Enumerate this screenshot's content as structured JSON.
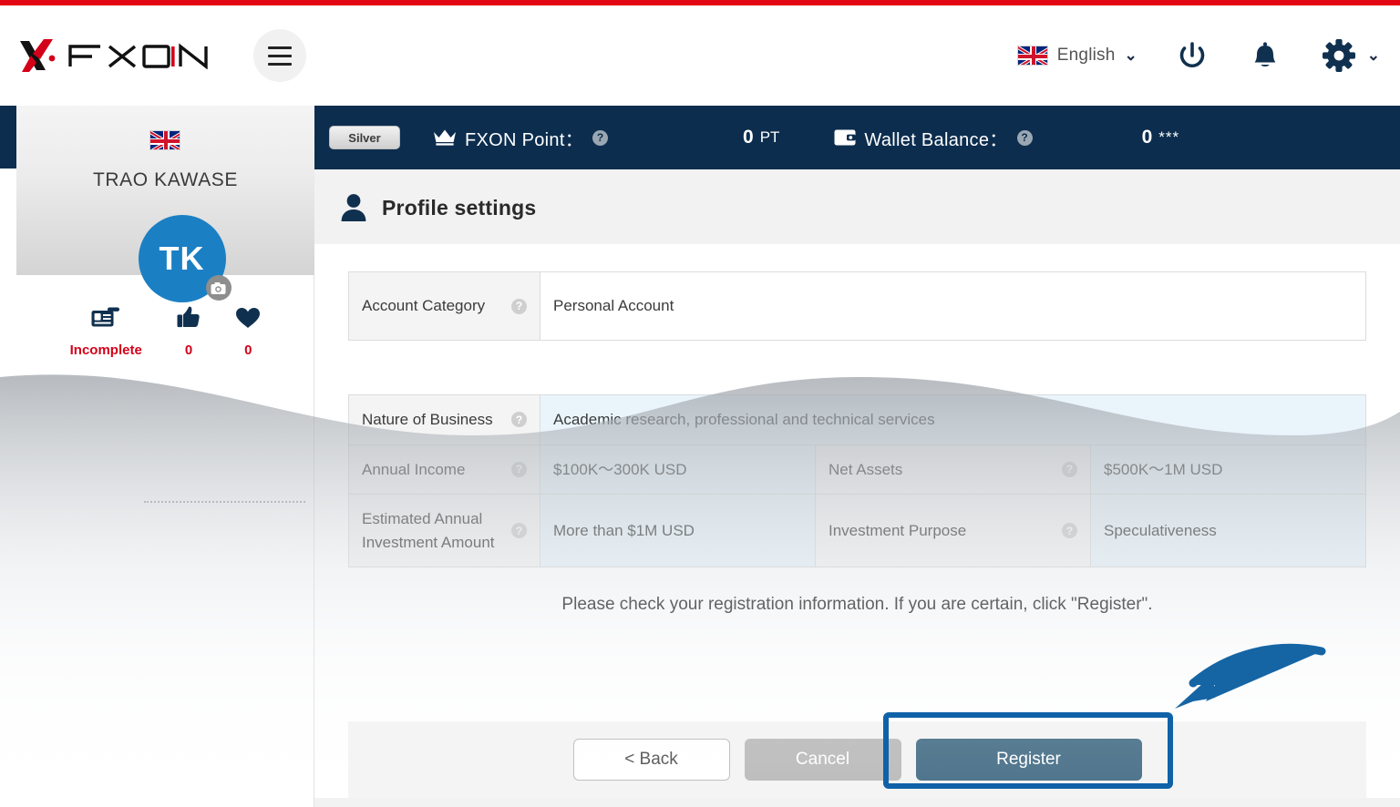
{
  "brand": {
    "name": "FXON",
    "logo_icon": "fxon-x-logo",
    "menu_icon": "hamburger-menu-icon"
  },
  "header": {
    "language": "English",
    "flag_icon": "uk-flag-icon",
    "chevron_icon": "chevron-down-icon",
    "power_icon": "power-icon",
    "bell_icon": "bell-notification-icon",
    "gear_icon": "gear-settings-icon"
  },
  "sidebar": {
    "flag_icon": "uk-flag-icon",
    "user_name": "TRAO KAWASE",
    "avatar_initials": "TK",
    "camera_icon": "camera-icon",
    "stats": [
      {
        "icon": "id-card-icon",
        "value": "Incomplete"
      },
      {
        "icon": "thumbs-up-icon",
        "value": "0"
      },
      {
        "icon": "heart-icon",
        "value": "0"
      }
    ]
  },
  "statusbar": {
    "rank_badge": "Silver",
    "crown_icon": "crown-icon",
    "point_label": "FXON Point：",
    "point_value": "0",
    "point_unit": "PT",
    "wallet_icon": "wallet-icon",
    "wallet_label": "Wallet Balance：",
    "wallet_value": "0",
    "wallet_masked": "***",
    "help_icon": "question-mark-icon"
  },
  "main": {
    "person_icon": "person-icon",
    "title": "Profile settings",
    "table_top": [
      {
        "label": "Account Category",
        "value": "Personal Account"
      }
    ],
    "table_rows": [
      {
        "cells": [
          {
            "label": "Nature of Business",
            "value": "Academic research, professional and technical services",
            "span": 3
          }
        ]
      },
      {
        "cells": [
          {
            "label": "Annual Income",
            "value": "$100K〜300K USD"
          },
          {
            "label": "Net Assets",
            "value": "$500K〜1M USD"
          }
        ]
      },
      {
        "cells": [
          {
            "label": "Estimated Annual Investment Amount",
            "value": "More than $1M USD"
          },
          {
            "label": "Investment Purpose",
            "value": "Speculativeness"
          }
        ]
      }
    ],
    "hint": "Please check your registration information. If you are certain, click \"Register\".",
    "buttons": {
      "back": "< Back",
      "cancel": "Cancel",
      "register": "Register"
    }
  },
  "annotation": {
    "arrow_icon": "curved-arrow-icon",
    "highlight_target": "register-button"
  },
  "colors": {
    "brand_red": "#e30613",
    "navy": "#0c2d4e",
    "accent_blue": "#0f62a8",
    "register_blue": "#4a7189",
    "value_cell": "#eaf5fb",
    "label_cell": "#f4f4f4",
    "avatar_blue": "#1b7fc4",
    "alert_red": "#d4001a"
  }
}
